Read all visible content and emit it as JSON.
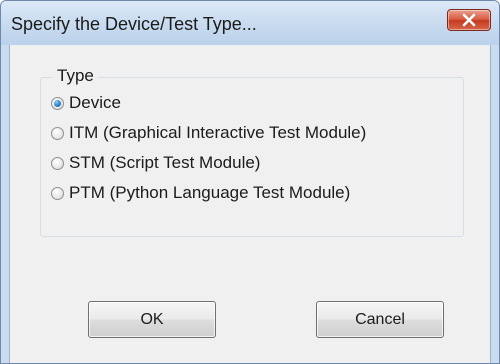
{
  "window": {
    "title": "Specify the Device/Test Type...",
    "close_icon": "close-icon"
  },
  "type_group": {
    "legend": "Type",
    "selected": "Device",
    "options": [
      {
        "label": "Device",
        "checked": true
      },
      {
        "label": "ITM (Graphical Interactive Test Module)",
        "checked": false
      },
      {
        "label": "STM (Script Test Module)",
        "checked": false
      },
      {
        "label": "PTM (Python Language Test Module)",
        "checked": false
      }
    ]
  },
  "buttons": {
    "ok_label": "OK",
    "cancel_label": "Cancel"
  },
  "colors": {
    "titlebar": "#c7daef",
    "close_button": "#d7593f",
    "dialog_background": "#f0f0f0",
    "radio_selected": "#2a7fc6"
  }
}
